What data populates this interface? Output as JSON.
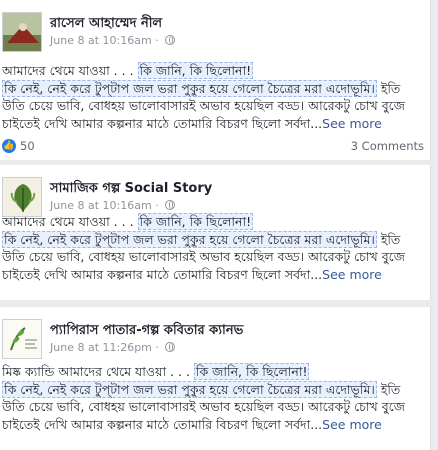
{
  "posts": [
    {
      "author": "রাসেল আহাম্মেদ নীল",
      "time": "June 8 at 10:16am",
      "text_prefix": "আমাদের থেমে যাওয়া . . . ",
      "highlight_1": "কি জানি, কি ছিলোনা!",
      "highlight_2": "কি নেই, নেই করে টুপ্‌টাপ জল ভরা পুকুর হয়ে গেলো চৈত্রের মরা এদোভূমি।",
      "line_2_tail": " ইতি",
      "line_3": "উতি চেয়ে ভাবি, বোধহয় ভালোবাসারই অভাব হয়েছিল বড্ড। আরেকটু চোখ বুজে",
      "line_4": "চাইতেই দেখি আমার কল্পনার মাঠে তোমারি বিচরণ ছিলো সর্বদা...",
      "see_more": "See more",
      "likes": "50",
      "comments": "3 Comments"
    },
    {
      "author": "সামাজিক গল্প Social Story",
      "time": "June 8 at 10:16am",
      "text_prefix": "আমাদের থেমে যাওয়া . . . ",
      "highlight_1": "কি জানি, কি ছিলোনা!",
      "highlight_2": "কি নেই, নেই করে টুপ্‌টাপ জল ভরা পুকুর হয়ে গেলো চৈত্রের মরা এদোভূমি।",
      "line_2_tail": " ইতি",
      "line_3": "উতি চেয়ে ভাবি, বোধহয় ভালোবাসারই অভাব হয়েছিল বড্ড। আরেকটু চোখ বুজে",
      "line_4": "চাইতেই দেখি আমার কল্পনার মাঠে তোমারি বিচরণ ছিলো সর্বদা...",
      "see_more": "See more"
    },
    {
      "author": "প্যাপিরাস পাতার-গল্প কবিতার ক্যানভ",
      "time": "June 8 at 11:26pm",
      "text_prefix": "মিষ্ক ক্যান্ডি আমাদের থেমে যাওয়া . . . ",
      "highlight_1": "কি জানি, কি ছিলোনা!",
      "highlight_2": "কি নেই, নেই করে টুপ্‌টাপ জল ভরা পুকুর হয়ে গেলো চৈত্রের মরা এদোভূমি।",
      "line_2_tail": " ইতি",
      "line_3": "উতি চেয়ে ভাবি, বোধহয় ভালোবাসারই অভাব হয়েছিল বড্ড। আরেকটু চোখ বুজে",
      "line_4": "চাইতেই দেখি আমার কল্পনার মাঠে তোমারি বিচরণ ছিলো সর্বদা...",
      "see_more": "See more"
    }
  ],
  "colors": {
    "link": "#385898",
    "meta": "#90949c",
    "like": "#2078f4",
    "highlight": "#e7f0ff"
  },
  "icons": {
    "privacy": "globe-icon",
    "reaction": "like-icon"
  }
}
